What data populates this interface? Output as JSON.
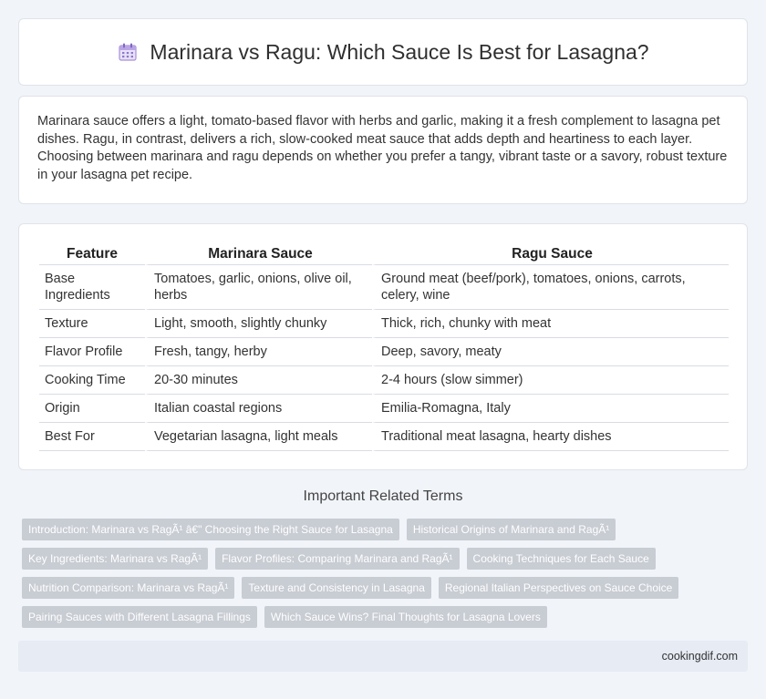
{
  "header": {
    "title": "Marinara vs Ragu: Which Sauce Is Best for Lasagna?",
    "icon": "calendar-icon"
  },
  "intro": {
    "text": "Marinara sauce offers a light, tomato-based flavor with herbs and garlic, making it a fresh complement to lasagna pet dishes. Ragu, in contrast, delivers a rich, slow-cooked meat sauce that adds depth and heartiness to each layer. Choosing between marinara and ragu depends on whether you prefer a tangy, vibrant taste or a savory, robust texture in your lasagna pet recipe."
  },
  "table": {
    "headers": [
      "Feature",
      "Marinara Sauce",
      "Ragu Sauce"
    ],
    "rows": [
      [
        "Base Ingredients",
        "Tomatoes, garlic, onions, olive oil, herbs",
        "Ground meat (beef/pork), tomatoes, onions, carrots, celery, wine"
      ],
      [
        "Texture",
        "Light, smooth, slightly chunky",
        "Thick, rich, chunky with meat"
      ],
      [
        "Flavor Profile",
        "Fresh, tangy, herby",
        "Deep, savory, meaty"
      ],
      [
        "Cooking Time",
        "20-30 minutes",
        "2-4 hours (slow simmer)"
      ],
      [
        "Origin",
        "Italian coastal regions",
        "Emilia-Romagna, Italy"
      ],
      [
        "Best For",
        "Vegetarian lasagna, light meals",
        "Traditional meat lasagna, hearty dishes"
      ]
    ]
  },
  "related": {
    "title": "Important Related Terms",
    "tags": [
      "Introduction: Marinara vs RagÃ¹ â€\" Choosing the Right Sauce for Lasagna",
      "Historical Origins of Marinara and RagÃ¹",
      "Key Ingredients: Marinara vs RagÃ¹",
      "Flavor Profiles: Comparing Marinara and RagÃ¹",
      "Cooking Techniques for Each Sauce",
      "Nutrition Comparison: Marinara vs RagÃ¹",
      "Texture and Consistency in Lasagna",
      "Regional Italian Perspectives on Sauce Choice",
      "Pairing Sauces with Different Lasagna Fillings",
      "Which Sauce Wins? Final Thoughts for Lasagna Lovers"
    ]
  },
  "footer": {
    "site": "cookingdif.com"
  },
  "colors": {
    "tag_bg": "#c8ccd3",
    "page_bg": "#f1f4f9",
    "footer_bg": "#e6ebf4"
  }
}
